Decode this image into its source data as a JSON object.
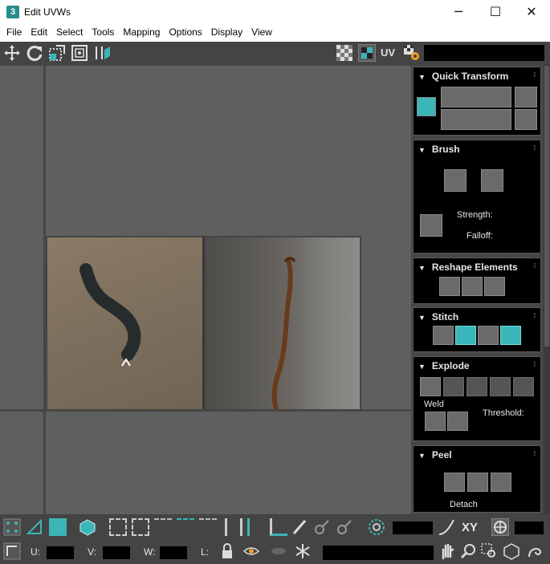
{
  "window": {
    "title": "Edit UVWs",
    "app_icon_label": "3",
    "minimize_glyph": "─",
    "maximize_glyph": "☐",
    "close_glyph": "✕"
  },
  "menubar": {
    "items": [
      "File",
      "Edit",
      "Select",
      "Tools",
      "Mapping",
      "Options",
      "Display",
      "View"
    ]
  },
  "toptoolbar": {
    "uv_label": "UV",
    "icons": [
      "move-icon",
      "rotate-icon",
      "scale-icon",
      "freeform-icon",
      "mirror-icon",
      "checker-icon",
      "pattern-icon",
      "settings-icon"
    ]
  },
  "panels": {
    "quick_transform": {
      "title": "Quick Transform"
    },
    "brush": {
      "title": "Brush",
      "strength_label": "Strength:",
      "falloff_label": "Falloff:"
    },
    "reshape": {
      "title": "Reshape Elements"
    },
    "stitch": {
      "title": "Stitch"
    },
    "explode": {
      "title": "Explode",
      "weld_label": "Weld",
      "threshold_label": "Threshold:"
    },
    "peel": {
      "title": "Peel",
      "detach_label": "Detach"
    }
  },
  "bottombar": {
    "xy_label": "XY",
    "u_label": "U:",
    "v_label": "V:",
    "w_label": "W:",
    "l_label": "L:"
  },
  "colors": {
    "accent": "#3ab6b8",
    "panel_bg": "#000000",
    "toolbar_bg": "#444444",
    "viewport_bg": "#5f5f5f"
  }
}
